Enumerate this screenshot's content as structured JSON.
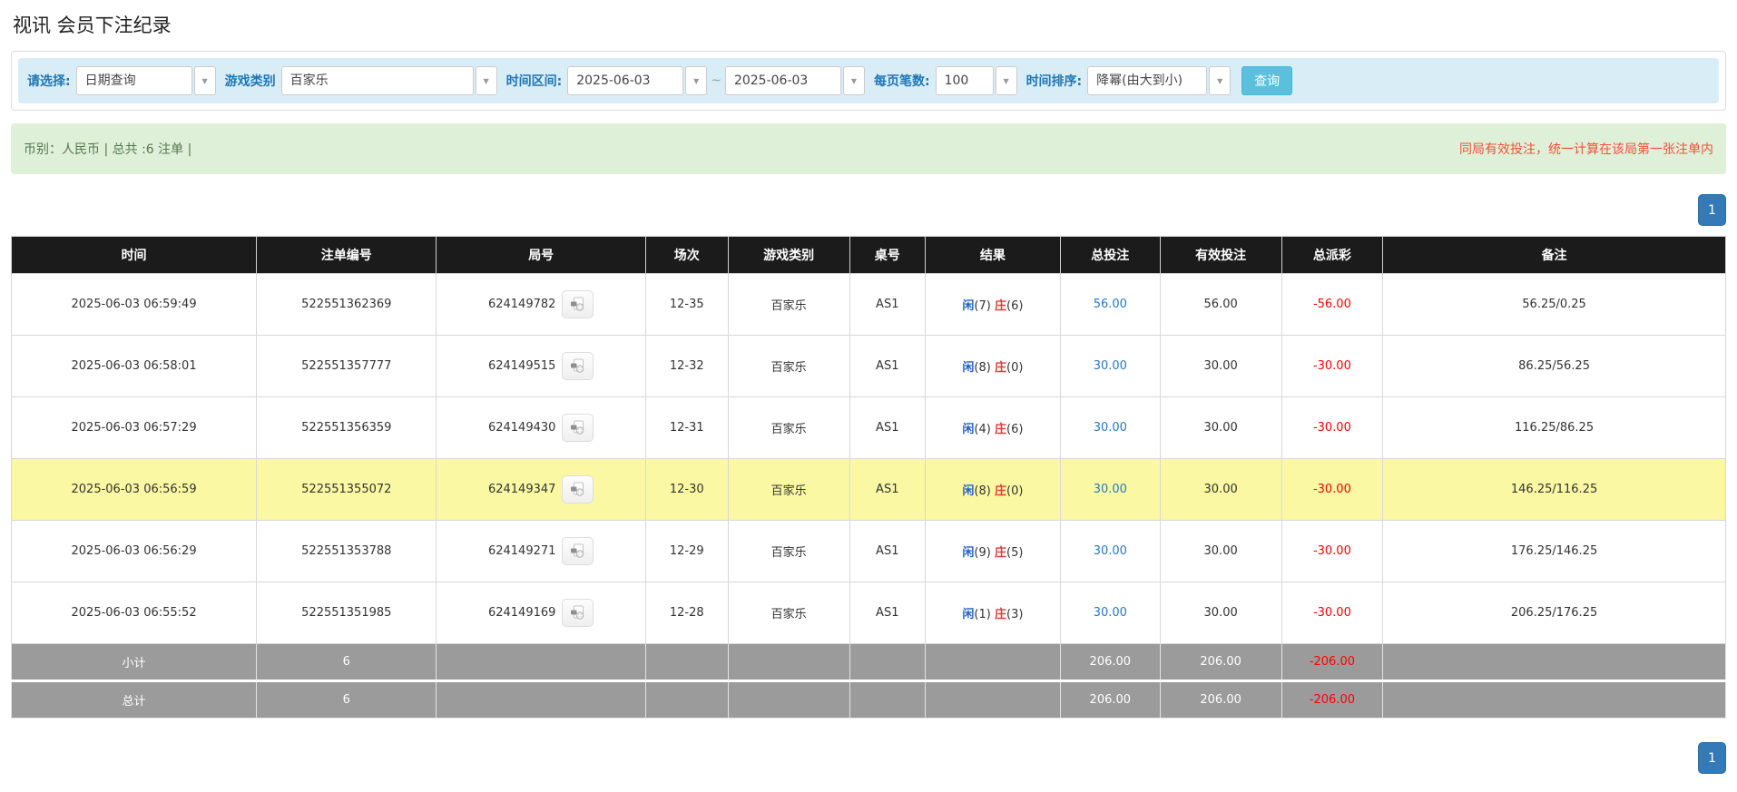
{
  "page": {
    "title": "视讯 会员下注纪录"
  },
  "filters": {
    "select_label": "请选择:",
    "select_value": "日期查询",
    "game_label": "游戏类别",
    "game_value": "百家乐",
    "range_label": "时间区间:",
    "date_from": "2025-06-03",
    "range_sep": "~",
    "date_to": "2025-06-03",
    "page_size_label": "每页笔数:",
    "page_size_value": "100",
    "sort_label": "时间排序:",
    "sort_value": "降幂(由大到小)",
    "search_button": "查询",
    "caret_icon": "▼"
  },
  "notice": {
    "left": "币别：人民币 | 总共 :6 注单 |",
    "right": "同局有效投注，统一计算在该局第一张注单内"
  },
  "pagination": {
    "page": "1"
  },
  "colors": {
    "accent_blue": "#337ab7",
    "search_button_blue": "#5bc0de",
    "link_blue": "#2778c4",
    "player_blue": "#2563c9",
    "banker_red": "#e4393c",
    "negative_red": "#ff0000",
    "highlight_yellow": "#fbf8a3",
    "filter_bg": "#d9edf7",
    "notice_bg": "#dff0d8",
    "table_header_bg": "#1b1b1b",
    "summary_bg": "#9b9b9b"
  },
  "table": {
    "headers": [
      "时间",
      "注单编号",
      "局号",
      "场次",
      "游戏类别",
      "桌号",
      "结果",
      "总投注",
      "有效投注",
      "总派彩",
      "备注"
    ],
    "rows": [
      {
        "time": "2025-06-03 06:59:49",
        "bet_id": "522551362369",
        "round_id": "624149782",
        "session": "12-35",
        "game": "百家乐",
        "table_no": "AS1",
        "result": {
          "player": "闲",
          "player_n": "(7)",
          "banker": "庄",
          "banker_n": "(6)"
        },
        "total_bet": "56.00",
        "valid_bet": "56.00",
        "payout": "-56.00",
        "remark": "56.25/0.25",
        "highlight": false
      },
      {
        "time": "2025-06-03 06:58:01",
        "bet_id": "522551357777",
        "round_id": "624149515",
        "session": "12-32",
        "game": "百家乐",
        "table_no": "AS1",
        "result": {
          "player": "闲",
          "player_n": "(8)",
          "banker": "庄",
          "banker_n": "(0)"
        },
        "total_bet": "30.00",
        "valid_bet": "30.00",
        "payout": "-30.00",
        "remark": "86.25/56.25",
        "highlight": false
      },
      {
        "time": "2025-06-03 06:57:29",
        "bet_id": "522551356359",
        "round_id": "624149430",
        "session": "12-31",
        "game": "百家乐",
        "table_no": "AS1",
        "result": {
          "player": "闲",
          "player_n": "(4)",
          "banker": "庄",
          "banker_n": "(6)"
        },
        "total_bet": "30.00",
        "valid_bet": "30.00",
        "payout": "-30.00",
        "remark": "116.25/86.25",
        "highlight": false
      },
      {
        "time": "2025-06-03 06:56:59",
        "bet_id": "522551355072",
        "round_id": "624149347",
        "session": "12-30",
        "game": "百家乐",
        "table_no": "AS1",
        "result": {
          "player": "闲",
          "player_n": "(8)",
          "banker": "庄",
          "banker_n": "(0)"
        },
        "total_bet": "30.00",
        "valid_bet": "30.00",
        "payout": "-30.00",
        "remark": "146.25/116.25",
        "highlight": true
      },
      {
        "time": "2025-06-03 06:56:29",
        "bet_id": "522551353788",
        "round_id": "624149271",
        "session": "12-29",
        "game": "百家乐",
        "table_no": "AS1",
        "result": {
          "player": "闲",
          "player_n": "(9)",
          "banker": "庄",
          "banker_n": "(5)"
        },
        "total_bet": "30.00",
        "valid_bet": "30.00",
        "payout": "-30.00",
        "remark": "176.25/146.25",
        "highlight": false
      },
      {
        "time": "2025-06-03 06:55:52",
        "bet_id": "522551351985",
        "round_id": "624149169",
        "session": "12-28",
        "game": "百家乐",
        "table_no": "AS1",
        "result": {
          "player": "闲",
          "player_n": "(1)",
          "banker": "庄",
          "banker_n": "(3)"
        },
        "total_bet": "30.00",
        "valid_bet": "30.00",
        "payout": "-30.00",
        "remark": "206.25/176.25",
        "highlight": false
      }
    ],
    "subtotal": {
      "label": "小计",
      "count": "6",
      "total_bet": "206.00",
      "valid_bet": "206.00",
      "payout": "-206.00"
    },
    "total": {
      "label": "总计",
      "count": "6",
      "total_bet": "206.00",
      "valid_bet": "206.00",
      "payout": "-206.00"
    }
  }
}
